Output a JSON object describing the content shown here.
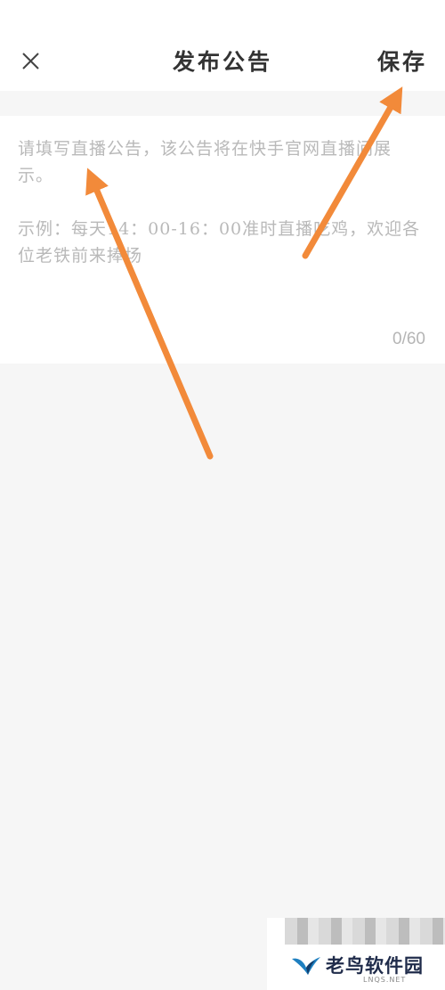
{
  "header": {
    "close_icon": "close-icon",
    "title": "发布公告",
    "save_label": "保存"
  },
  "editor": {
    "value": "",
    "placeholder": "请填写直播公告，该公告将在快手官网直播间展示。\n\n示例：每天14：00-16：00准时直播吃鸡，欢迎各位老铁前来捧场",
    "char_count": "0/60"
  },
  "annotations": {
    "arrow_color": "#f28a3a",
    "arrows": [
      "points to save button",
      "points to announcement input"
    ]
  },
  "watermark": {
    "brand": "老鸟软件园",
    "sub": "LNQS.NET",
    "logo_icon": "bird-logo-icon"
  },
  "colors": {
    "background": "#f6f6f6",
    "surface": "#ffffff",
    "title_text": "#333333",
    "placeholder_text": "#b9b9b9",
    "counter_text": "#b5b5b5"
  }
}
